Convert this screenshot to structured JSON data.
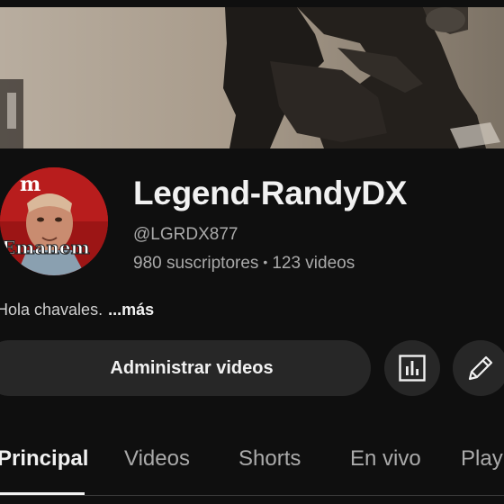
{
  "channel": {
    "name": "Legend-RandyDX",
    "handle": "@LGRDX877",
    "subscribers": "980 suscriptores",
    "separator": "•",
    "videos": "123 videos",
    "description": "Hola chavales.",
    "more_label": "...más"
  },
  "avatar": {
    "text": "Emanem",
    "logo_letter": "m"
  },
  "actions": {
    "manage_videos_label": "Administrar videos",
    "analytics_icon": "analytics-icon",
    "edit_icon": "pencil-icon"
  },
  "tabs": [
    {
      "label": "Principal",
      "active": true
    },
    {
      "label": "Videos",
      "active": false
    },
    {
      "label": "Shorts",
      "active": false
    },
    {
      "label": "En vivo",
      "active": false
    },
    {
      "label": "Playlists",
      "active": false
    }
  ],
  "colors": {
    "background": "#0f0f0f",
    "button_bg": "#272727",
    "text_primary": "#f1f1f1",
    "text_secondary": "#aaaaaa"
  }
}
